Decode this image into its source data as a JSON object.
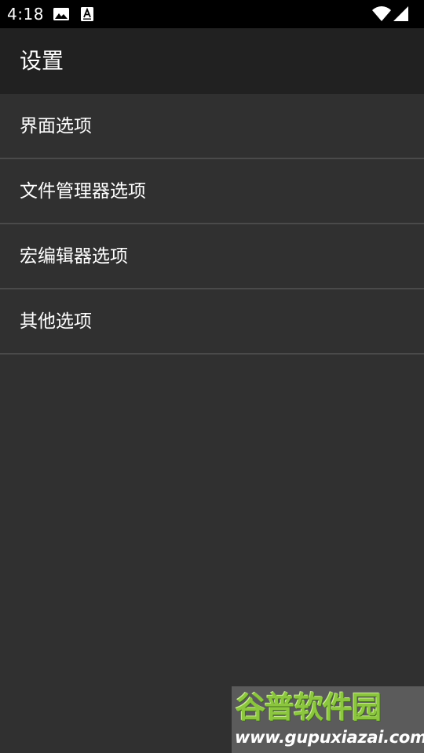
{
  "status_bar": {
    "time": "4:18",
    "icons": [
      "image-notification-icon",
      "text-notification-icon",
      "wifi-icon",
      "cellular-signal-icon"
    ]
  },
  "app_bar": {
    "title": "设置"
  },
  "settings": {
    "items": [
      {
        "label": "界面选项"
      },
      {
        "label": "文件管理器选项"
      },
      {
        "label": "宏编辑器选项"
      },
      {
        "label": "其他选项"
      }
    ]
  },
  "watermark": {
    "title": "谷普软件园",
    "url": "www.gupuxiazai.com"
  },
  "colors": {
    "background": "#303030",
    "app_bar": "#212121",
    "status_bar": "#000000",
    "divider": "#4a4a4a",
    "text": "#ffffff",
    "watermark_green": "#8cc63f"
  }
}
